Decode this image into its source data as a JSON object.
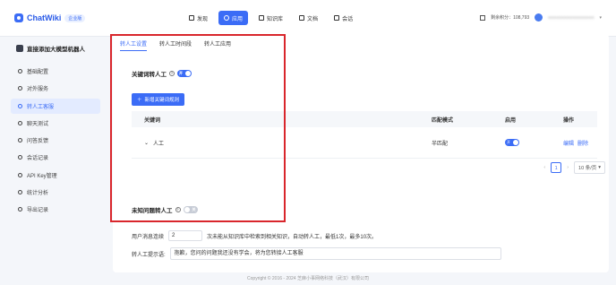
{
  "app": {
    "logo_text": "ChatWiki",
    "edition_badge": "企业版",
    "brand_color": "#3b6cf6",
    "highlight_color": "#d9262c"
  },
  "topnav": [
    {
      "label": "发现",
      "icon": "discover-icon",
      "active": false
    },
    {
      "label": "应用",
      "icon": "app-icon",
      "active": true
    },
    {
      "label": "知识库",
      "icon": "knowledge-base-icon",
      "active": false
    },
    {
      "label": "文档",
      "icon": "document-icon",
      "active": false
    },
    {
      "label": "会话",
      "icon": "chat-icon",
      "active": false
    }
  ],
  "account": {
    "credits_label": "剩余积分：108,793",
    "user_name": "●●●●●●●●●●●●●●●●●"
  },
  "sidebar": {
    "bot_name": "直接添加大模型机器人",
    "items": [
      {
        "label": "基础配置",
        "icon": "settings-icon",
        "active": false
      },
      {
        "label": "对外服务",
        "icon": "service-icon",
        "active": false
      },
      {
        "label": "转人工客服",
        "icon": "human-agent-icon",
        "active": true
      },
      {
        "label": "聊天测试",
        "icon": "chat-test-icon",
        "active": false
      },
      {
        "label": "问答反馈",
        "icon": "feedback-icon",
        "active": false
      },
      {
        "label": "会话记录",
        "icon": "history-icon",
        "active": false
      },
      {
        "label": "API Key管理",
        "icon": "api-key-icon",
        "active": false
      },
      {
        "label": "统计分析",
        "icon": "stats-icon",
        "active": false
      },
      {
        "label": "导出记录",
        "icon": "export-icon",
        "active": false
      }
    ]
  },
  "tabs": [
    {
      "label": "转人工设置",
      "active": true
    },
    {
      "label": "转人工时间段",
      "active": false
    },
    {
      "label": "转人工应用",
      "active": false
    }
  ],
  "keyword_section": {
    "title": "关键词转人工",
    "switch_text": "开",
    "enabled": true,
    "add_button": "新增关键词规则"
  },
  "table": {
    "headers": {
      "keyword": "关键词",
      "mode": "匹配模式",
      "enabled": "启用",
      "actions": "操作"
    },
    "rows": [
      {
        "keyword": "人工",
        "mode": "半匹配",
        "switch_text": "开",
        "enabled": true,
        "edit": "编辑",
        "delete": "删除"
      }
    ]
  },
  "pagination": {
    "prev": "‹",
    "current": "1",
    "next": "›",
    "page_size": "10 条/页"
  },
  "unknown_section": {
    "title": "未知问题转人工",
    "switch_text": "关",
    "enabled": false,
    "consecutive_label": "用户消息连续",
    "consecutive_value": "2",
    "consecutive_suffix": "次未能从知识库中检索到相关知识，自动转人工，最低1次，最多10次。",
    "prompt_label": "转人工提示语:",
    "prompt_value": "抱歉，您问的问题我还没有学会，将为您转接人工客服"
  },
  "footer": "Copyright © 2016 - 2024 芝麻小事网络科技（武汉）有限公司"
}
